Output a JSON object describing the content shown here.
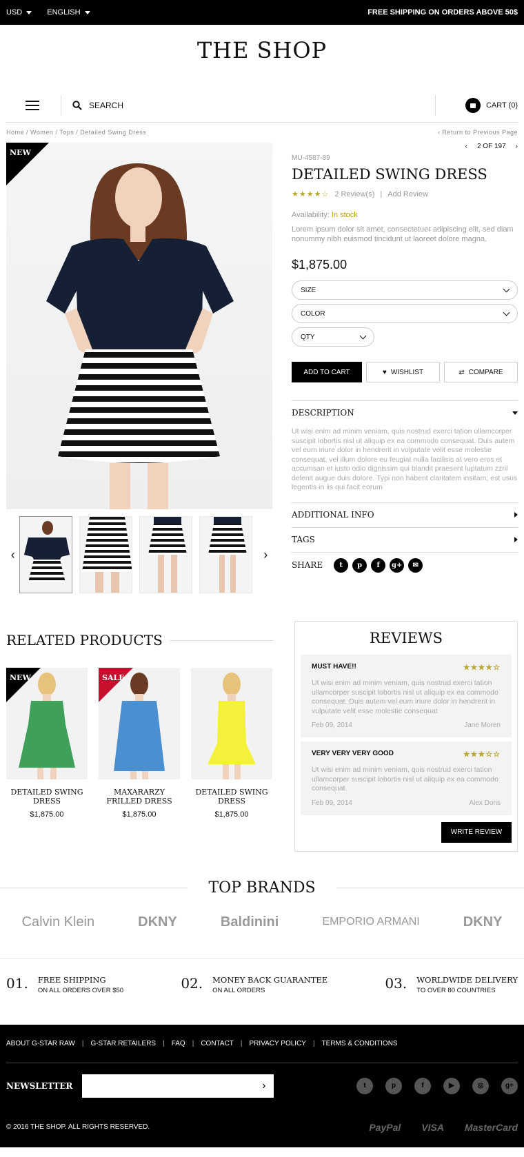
{
  "topbar": {
    "currency": "USD",
    "language": "ENGLISH",
    "shipping_notice": "FREE SHIPPING ON ORDERS ABOVE 50$"
  },
  "header": {
    "logo": "THE SHOP",
    "search_label": "SEARCH",
    "cart_label": "CART (0)"
  },
  "breadcrumb": {
    "path": "Home  /  Women / Tops / Detailed Swing Dress",
    "back": "‹  Return to Previous Page"
  },
  "product": {
    "badge": "NEW",
    "pager": "2 OF 197",
    "sku": "MU-4587-89",
    "title": "DETAILED SWING DRESS",
    "stars": "★★★★☆",
    "rating_value": 4,
    "reviews_link": "2 Review(s)",
    "add_review": "Add Review",
    "availability_label": "Availability:",
    "availability_value": "In stock",
    "short_desc": "Lorem ipsum dolor sit amet, consectetuer adipiscing elit, sed diam nonummy nibh euismod tincidunt ut laoreet dolore magna.",
    "price": "$1,875.00",
    "size_label": "SIZE",
    "color_label": "COLOR",
    "qty_label": "QTY",
    "add_to_cart": "ADD TO CART",
    "wishlist": "WISHLIST",
    "compare": "COMPARE",
    "description_title": "DESCRIPTION",
    "description_text": "Ut wisi enim ad minim veniam, quis nostrud exerci tation ullamcorper suscipit lobortis nisl ut aliquip ex ea commodo consequat. Duis autem vel eum iriure dolor in hendrerit in vulputate velit esse molestie consequat, vel illum dolore eu feugiat nulla facilisis at vero eros et accumsan et iusto odio dignissim qui blandit praesent luptatum zzril delenit augue duis dolore. Typi non habent claritatem insitam; est usus legentis in iis qui facit eorum",
    "additional_info": "ADDITIONAL INFO",
    "tags": "TAGS",
    "share": "SHARE"
  },
  "related": {
    "title": "RELATED PRODUCTS",
    "items": [
      {
        "badge": "NEW",
        "name": "DETAILED SWING DRESS",
        "price": "$1,875.00",
        "color": "#3fa05a"
      },
      {
        "badge": "SALE",
        "name": "MAXARARZY FRILLED DRESS",
        "price": "$1,875.00",
        "color": "#4a8fd0"
      },
      {
        "badge": "",
        "name": "DETAILED SWING DRESS",
        "price": "$1,875.00",
        "color": "#f3f13a"
      }
    ]
  },
  "reviews": {
    "title": "REVIEWS",
    "items": [
      {
        "title": "MUST HAVE!!",
        "stars": "★★★★☆",
        "rating": 4,
        "text": "Ut wisi enim ad minim veniam, quis nostrud exerci tation ullamcorper suscipit lobortis nisl ut aliquip ex ea commodo consequat. Duis autem vel eum iriure dolor in hendrerit in vulputate velit esse molestie consequat",
        "date": "Feb 09, 2014",
        "author": "Jane Moren"
      },
      {
        "title": "VERY VERY VERY GOOD",
        "stars": "★★★☆☆",
        "rating": 3,
        "text": "Ut wisi enim ad minim veniam, quis nostrud exerci tation ullamcorper suscipit lobortis nisl ut aliquip ex ea commodo consequat.",
        "date": "Feb 09, 2014",
        "author": "Alex Doris"
      }
    ],
    "write_review": "WRITE REVIEW"
  },
  "brands": {
    "title": "TOP BRANDS",
    "items": [
      "Calvin Klein",
      "DKNY",
      "Baldinini",
      "EMPORIO ARMANI",
      "DKNY"
    ]
  },
  "features": [
    {
      "num": "01.",
      "title": "FREE SHIPPING",
      "sub": "ON ALL ORDERS OVER $50"
    },
    {
      "num": "02.",
      "title": "MONEY BACK GUARANTEE",
      "sub": "ON ALL ORDERS"
    },
    {
      "num": "03.",
      "title": "WORLDWIDE DELIVERY",
      "sub": "TO OVER 80 COUNTRIES"
    }
  ],
  "footer": {
    "links": [
      "ABOUT G-STAR RAW",
      "G-STAR RETAILERS",
      "FAQ",
      "CONTACT",
      "PRIVACY POLICY",
      "TERMS & CONDITIONS"
    ],
    "newsletter": "NEWSLETTER",
    "copyright": "© 2016 THE SHOP. ALL RIGHTS RESERVED.",
    "payments": [
      "PayPal",
      "VISA",
      "MasterCard"
    ]
  }
}
